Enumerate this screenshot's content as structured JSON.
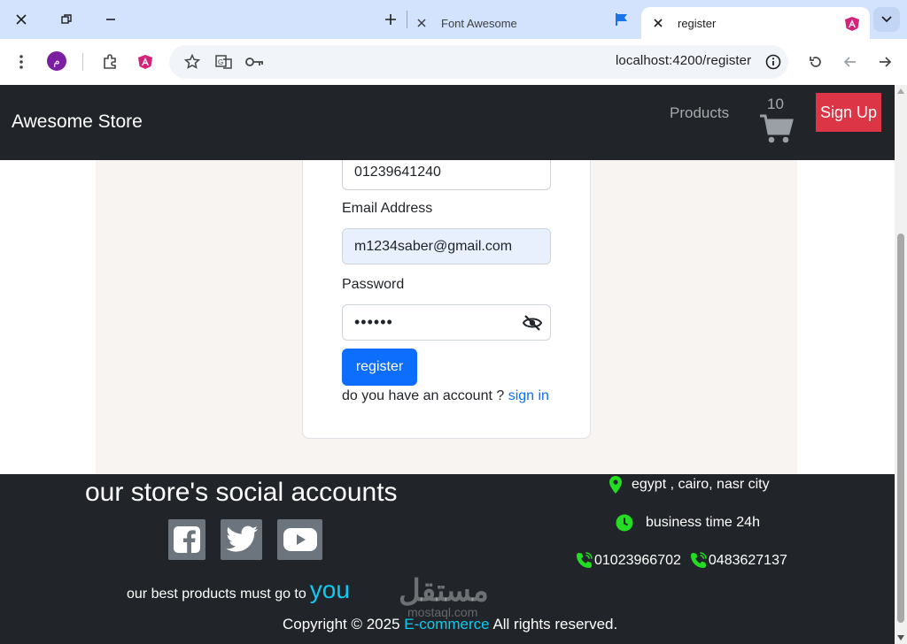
{
  "browser": {
    "tabs": [
      {
        "title": "Font Awesome",
        "active": false
      },
      {
        "title": "register",
        "active": true
      }
    ],
    "profile_initial": "م",
    "url": "localhost:4200/register"
  },
  "navbar": {
    "brand": "Awesome Store",
    "products_link": "Products",
    "cart_count": "10",
    "signup_label": "Sign Up"
  },
  "form": {
    "phone_value": "01239641240",
    "email_label": "Email Address",
    "email_value": "m1234saber@gmail.com",
    "password_label": "Password",
    "password_value": "••••••",
    "register_label": "register",
    "have_account_text": "do you have an account ?",
    "signin_link": "sign in"
  },
  "footer": {
    "title": "our store's social accounts",
    "best_text": "our best products must go to",
    "you_text": "you",
    "address": "egypt , cairo, nasr city",
    "business_time": "business time 24h",
    "phone1": "01023966702",
    "phone2": "0483627137",
    "copyright_prefix": "Copyright © 2025",
    "copyright_link": "E-commerce",
    "copyright_suffix": "All rights reserved.",
    "watermark": "مستقل",
    "watermark_sub": "mostaql.com"
  },
  "colors": {
    "navbar_bg": "#212529",
    "signup_bg": "#dc3545",
    "primary": "#0d6efd",
    "accent_cyan": "#0dcaf0",
    "icon_green": "#22dd22"
  }
}
